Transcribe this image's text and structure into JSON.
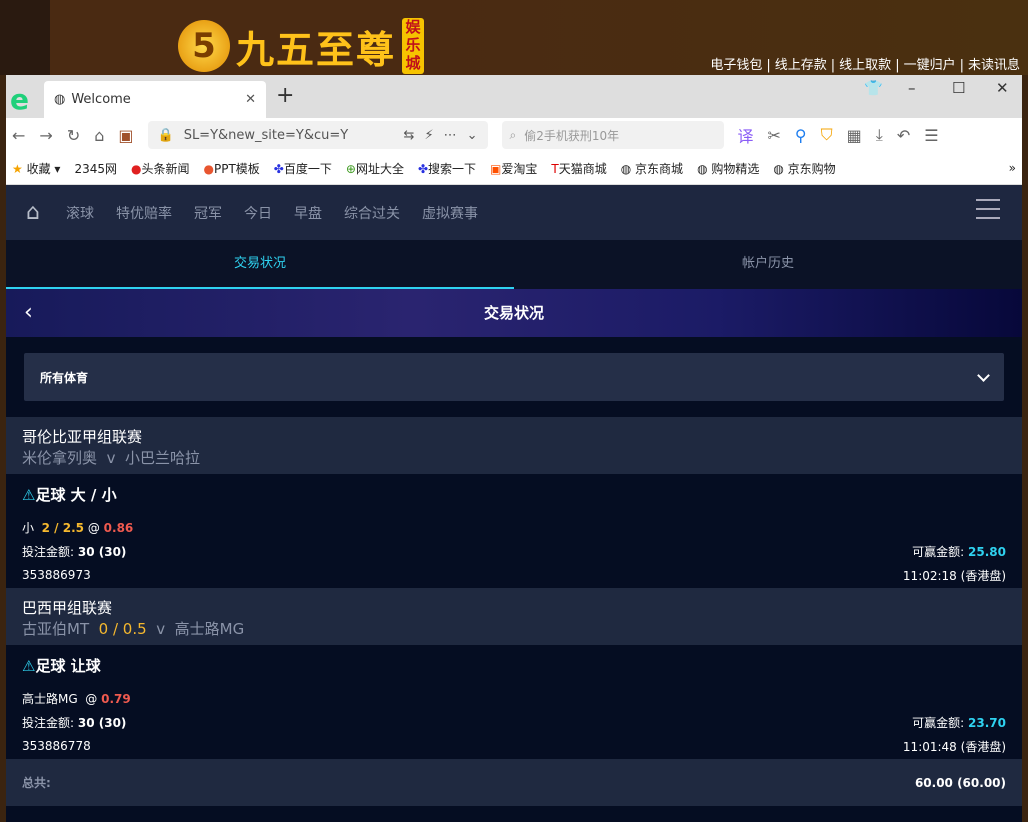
{
  "site": {
    "logo_text": "九五至尊",
    "logo_badge": "娱乐城",
    "links": [
      "电子钱包",
      "线上存款",
      "线上取款",
      "一键归户",
      "未读讯息"
    ]
  },
  "browser": {
    "tab_title": "Welcome",
    "address": "SL=Y&new_site=Y&cu=Y",
    "search_placeholder": "偷2手机获刑10年",
    "bookmarks": [
      "收藏",
      "2345网",
      "头条新闻",
      "PPT模板",
      "百度一下",
      "网址大全",
      "搜索一下",
      "爱淘宝",
      "天猫商城",
      "京东商城",
      "购物精选",
      "京东购物"
    ]
  },
  "nav": {
    "items": [
      "滚球",
      "特优赔率",
      "冠军",
      "今日",
      "早盘",
      "综合过关",
      "虚拟赛事"
    ]
  },
  "tabs": [
    "交易状况",
    "帐户历史"
  ],
  "banner_title": "交易状况",
  "filter": {
    "selected": "所有体育"
  },
  "bets": [
    {
      "league": "哥伦比亚甲组联赛",
      "home": "米伦拿列奥",
      "vs": "v",
      "away": "小巴兰哈拉",
      "handicap": "",
      "type": "足球 大 / 小",
      "selection": "小",
      "line": "2 / 2.5",
      "at": "@",
      "odds": "0.86",
      "stake_label": "投注金额:",
      "stake": "30 (30)",
      "win_label": "可赢金额:",
      "win": "25.80",
      "id": "353886973",
      "time": "11:02:18 (香港盘)"
    },
    {
      "league": "巴西甲组联赛",
      "home": "古亚伯MT",
      "vs": "v",
      "away": "高士路MG",
      "handicap": "0 / 0.5",
      "type": "足球 让球",
      "selection": "高士路MG",
      "line": "",
      "at": "@",
      "odds": "0.79",
      "stake_label": "投注金额:",
      "stake": "30 (30)",
      "win_label": "可赢金额:",
      "win": "23.70",
      "id": "353886778",
      "time": "11:01:48 (香港盘)"
    }
  ],
  "total": {
    "label": "总共:",
    "value": "60.00 (60.00)"
  }
}
